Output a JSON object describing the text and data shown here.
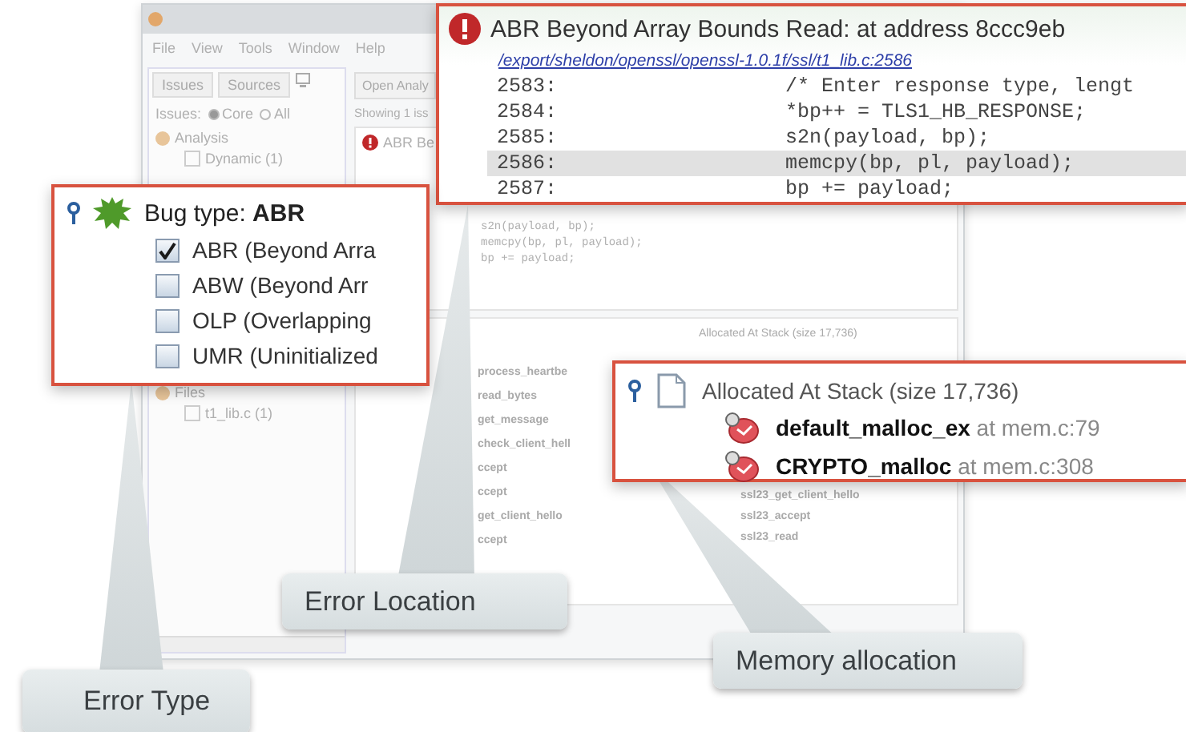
{
  "window": {
    "menu": [
      "File",
      "View",
      "Tools",
      "Window",
      "Help"
    ],
    "left_tabs": [
      "Issues",
      "Sources"
    ],
    "filter": {
      "label": "Issues:",
      "options": [
        {
          "label": "Core",
          "selected": true
        },
        {
          "label": "All",
          "selected": false
        }
      ]
    },
    "tree": [
      {
        "label": "Analysis",
        "children": [
          {
            "label": "Dynamic (1)",
            "checked": false
          }
        ]
      },
      {
        "label": "Files",
        "children": [
          {
            "label": "t1_lib.c (1)",
            "checked": false
          }
        ]
      }
    ],
    "toolbar_button": "Open Analy",
    "summary": "Showing 1 iss",
    "issue_title": "ABR Be",
    "faded_code": [
      "s2n(payload, bp);",
      "memcpy(bp, pl, payload);",
      "bp += payload;"
    ],
    "call_stack": [
      "process_heartbe",
      "read_bytes",
      "get_message",
      "check_client_hell",
      "ccept",
      "ccept",
      "get_client_hello",
      "ccept"
    ],
    "allocation_title": "Allocated At Stack (size 17,736)",
    "allocation_stack": [
      "ssl23_get_client_hello",
      "ssl23_accept",
      "ssl23_read"
    ]
  },
  "error_popup": {
    "title": "ABR Beyond Array Bounds Read: at address 8ccc9eb",
    "file_link": "/export/sheldon/openssl/openssl-1.0.1f/ssl/t1_lib.c:2586",
    "lines": [
      {
        "number": "2583:",
        "code": "/* Enter response type, lengt",
        "selected": false
      },
      {
        "number": "2584:",
        "code": "*bp++ = TLS1_HB_RESPONSE;",
        "selected": false
      },
      {
        "number": "2585:",
        "code": "s2n(payload, bp);",
        "selected": false
      },
      {
        "number": "2586:",
        "code": "memcpy(bp, pl, payload);",
        "selected": true
      },
      {
        "number": "2587:",
        "code": "bp += payload;",
        "selected": false
      }
    ]
  },
  "bug_type_popup": {
    "title": "Bug type: **ABR**",
    "options": [
      {
        "label": "ABR (Beyond Arra",
        "checked": true
      },
      {
        "label": "ABW (Beyond Arr",
        "checked": false
      },
      {
        "label": "OLP (Overlapping",
        "checked": false
      },
      {
        "label": "UMR (Uninitialized",
        "checked": false
      }
    ]
  },
  "allocation_popup": {
    "title": "Allocated At Stack (size 17,736)",
    "frames": [
      {
        "function": "default_malloc_ex",
        "location": "at mem.c:79"
      },
      {
        "function": "CRYPTO_malloc",
        "location": "at mem.c:308"
      }
    ]
  },
  "callouts": [
    {
      "label": "Error Location"
    },
    {
      "label": "Error Type"
    },
    {
      "label": "Memory allocation"
    }
  ]
}
